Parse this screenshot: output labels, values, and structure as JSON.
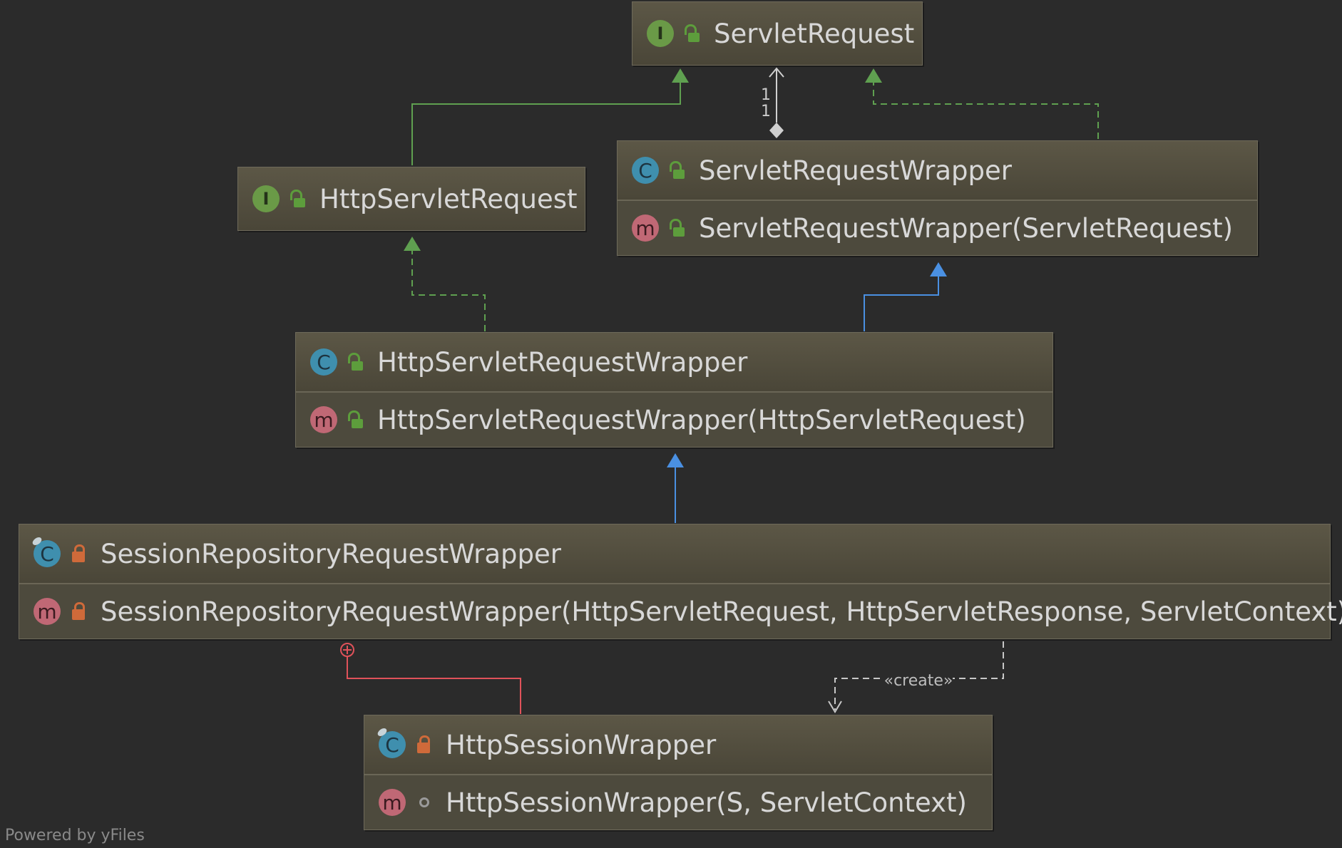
{
  "nodes": {
    "servlet_request": {
      "name": "ServletRequest",
      "kind": "interface",
      "visibility": "public"
    },
    "http_servlet_request": {
      "name": "HttpServletRequest",
      "kind": "interface",
      "visibility": "public"
    },
    "servlet_request_wrapper": {
      "name": "ServletRequestWrapper",
      "kind": "class",
      "visibility": "public",
      "members": [
        {
          "text": "ServletRequestWrapper(ServletRequest)",
          "visibility": "public"
        }
      ]
    },
    "http_servlet_request_wrapper": {
      "name": "HttpServletRequestWrapper",
      "kind": "class",
      "visibility": "public",
      "members": [
        {
          "text": "HttpServletRequestWrapper(HttpServletRequest)",
          "visibility": "public"
        }
      ]
    },
    "session_repository_request_wrapper": {
      "name": "SessionRepositoryRequestWrapper",
      "kind": "static-class",
      "visibility": "private",
      "members": [
        {
          "text": "SessionRepositoryRequestWrapper(HttpServletRequest, HttpServletResponse, ServletContext)",
          "visibility": "private"
        }
      ]
    },
    "http_session_wrapper": {
      "name": "HttpSessionWrapper",
      "kind": "static-class",
      "visibility": "private",
      "members": [
        {
          "text": "HttpSessionWrapper(S, ServletContext)",
          "visibility": "package"
        }
      ]
    }
  },
  "relations": {
    "aggregation_multiplicity_top": "1",
    "aggregation_multiplicity_bottom": "1",
    "create_label": "«create»"
  },
  "badges": {
    "interface": "I",
    "class": "C",
    "method": "m"
  },
  "colors": {
    "background": "#2b2b2b",
    "implements": "#5fa050",
    "extends": "#4a90e2",
    "inner": "#e0525a",
    "dependency": "#c8c8c8"
  },
  "footer": "Powered by yFiles"
}
